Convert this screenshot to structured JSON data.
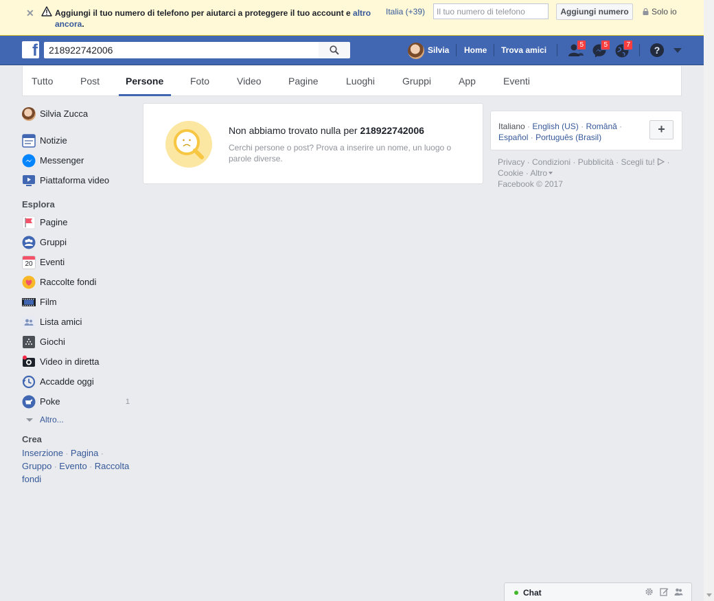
{
  "banner": {
    "message": "Aggiungi il tuo numero di telefono per aiutarci a proteggere il tuo account e ",
    "more_link": "altro ancora",
    "period": ".",
    "country": "Italia (+39)",
    "phone_placeholder": "Il tuo numero di telefono",
    "add_button": "Aggiungi numero",
    "privacy": "Solo io"
  },
  "header": {
    "search_value": "218922742006",
    "user_name": "Silvia",
    "home": "Home",
    "find_friends": "Trova amici",
    "friend_requests_count": "5",
    "messages_count": "5",
    "notifications_count": "7",
    "help": "?"
  },
  "tabs": [
    "Tutto",
    "Post",
    "Persone",
    "Foto",
    "Video",
    "Pagine",
    "Luoghi",
    "Gruppi",
    "App",
    "Eventi"
  ],
  "active_tab": "Persone",
  "left_nav": {
    "profile": "Silvia Zucca",
    "main_items": [
      {
        "label": "Notizie",
        "icon": "news-feed-icon"
      },
      {
        "label": "Messenger",
        "icon": "messenger-icon"
      },
      {
        "label": "Piattaforma video",
        "icon": "video-platform-icon"
      }
    ],
    "explore_title": "Esplora",
    "explore_items": [
      {
        "label": "Pagine",
        "icon": "pages-flag-icon"
      },
      {
        "label": "Gruppi",
        "icon": "groups-icon"
      },
      {
        "label": "Eventi",
        "icon": "calendar-icon",
        "icon_text": "20"
      },
      {
        "label": "Raccolte fondi",
        "icon": "fundraiser-heart-icon"
      },
      {
        "label": "Film",
        "icon": "film-icon"
      },
      {
        "label": "Lista amici",
        "icon": "friend-list-icon"
      },
      {
        "label": "Giochi",
        "icon": "games-icon"
      },
      {
        "label": "Video in diretta",
        "icon": "live-video-icon"
      },
      {
        "label": "Accadde oggi",
        "icon": "on-this-day-icon"
      },
      {
        "label": "Poke",
        "icon": "poke-icon",
        "count": "1"
      }
    ],
    "more": "Altro...",
    "create_title": "Crea",
    "create_links": [
      "Inserzione",
      "Pagina",
      "Gruppo",
      "Evento",
      "Raccolta fondi"
    ]
  },
  "results": {
    "title_prefix": "Non abbiamo trovato nulla per ",
    "query": "218922742006",
    "subtitle": "Cerchi persone o post? Prova a inserire un nome, un luogo o parole diverse."
  },
  "languages": {
    "current": "Italiano",
    "others": [
      "English (US)",
      "Română",
      "Español",
      "Português (Brasil)"
    ],
    "plus": "+"
  },
  "footer": {
    "links": [
      "Privacy",
      "Condizioni",
      "Pubblicità",
      "Scegli tu!",
      "Cookie",
      "Altro"
    ],
    "copyright": "Facebook © 2017"
  },
  "chat": {
    "label": "Chat"
  },
  "colors": {
    "brand_blue": "#4267b2",
    "link_blue": "#365899",
    "banner_yellow": "#fff9d7",
    "badge_red": "#fa3e3e",
    "online_green": "#42b72a"
  }
}
